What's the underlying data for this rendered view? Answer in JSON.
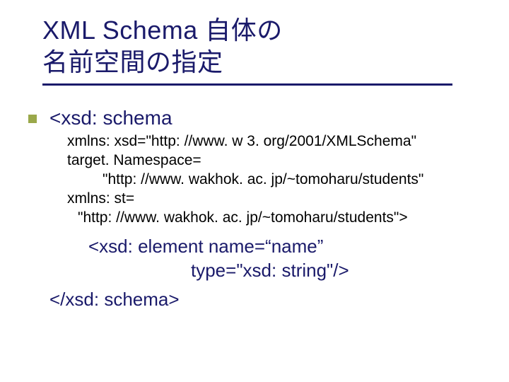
{
  "title": {
    "line1": "XML Schema 自体の",
    "line2": "名前空間の指定"
  },
  "schema_open": "<xsd: schema",
  "attrs": {
    "xmlns_xsd": "xmlns: xsd=\"http: //www. w 3. org/2001/XMLSchema\"",
    "target_ns_key": "target. Namespace=",
    "target_ns_val": "\"http: //www. wakhok. ac. jp/~tomoharu/students\"",
    "xmlns_st_key": "xmlns: st=",
    "xmlns_st_val": "\"http: //www. wakhok. ac. jp/~tomoharu/students\">"
  },
  "element": {
    "line1": "<xsd: element name=“name”",
    "line2": "type=\"xsd: string\"/>"
  },
  "schema_close": "</xsd: schema>"
}
